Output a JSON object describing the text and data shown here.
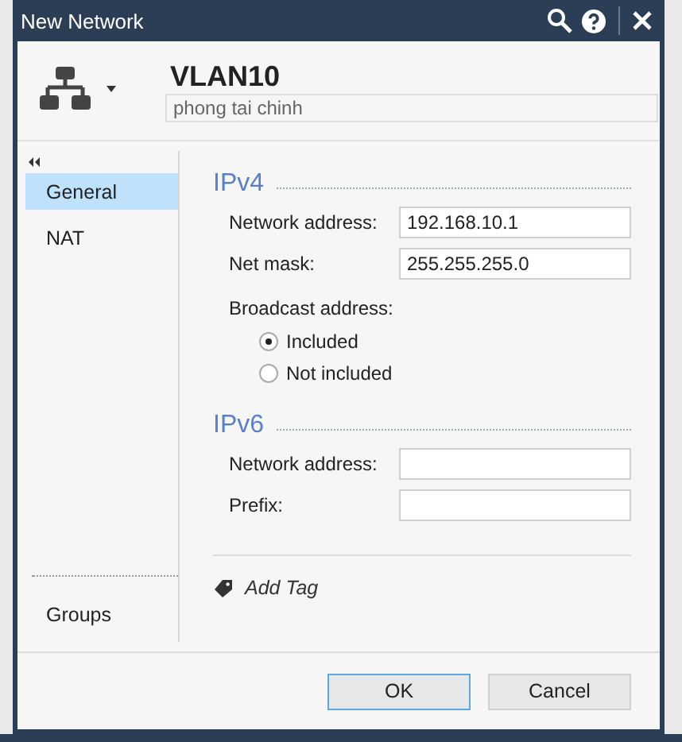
{
  "window": {
    "title": "New Network"
  },
  "header": {
    "name": "VLAN10",
    "comment": "phong tai chinh"
  },
  "sidebar": {
    "items": [
      {
        "label": "General",
        "selected": true
      },
      {
        "label": "NAT",
        "selected": false
      }
    ],
    "bottom_items": [
      {
        "label": "Groups",
        "selected": false
      }
    ]
  },
  "sections": [
    {
      "heading": "IPv4",
      "fields": [
        {
          "label": "Network address:",
          "value": "192.168.10.1"
        },
        {
          "label": "Net mask:",
          "value": "255.255.255.0"
        }
      ],
      "broadcast": {
        "label": "Broadcast address:",
        "options": [
          {
            "label": "Included",
            "selected": true
          },
          {
            "label": "Not included",
            "selected": false
          }
        ]
      }
    },
    {
      "heading": "IPv6",
      "fields": [
        {
          "label": "Network address:"
        },
        {
          "label": "Prefix:"
        }
      ]
    }
  ],
  "add_tag": "Add Tag",
  "buttons": [
    {
      "label": "OK",
      "focused": true
    },
    {
      "label": "Cancel",
      "focused": false
    }
  ]
}
